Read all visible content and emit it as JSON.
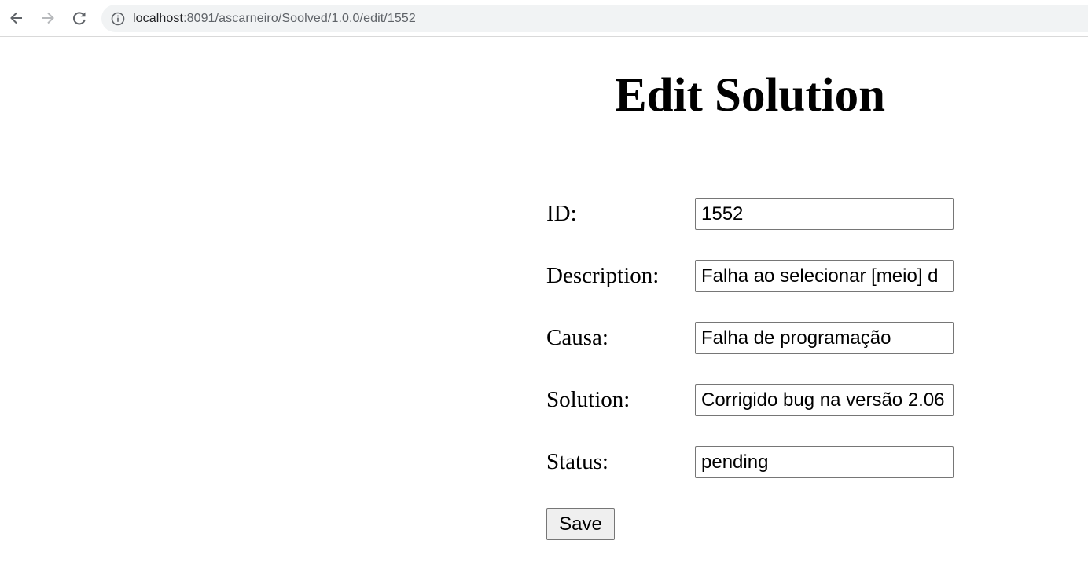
{
  "browser": {
    "url_host": "localhost",
    "url_path": ":8091/ascarneiro/Soolved/1.0.0/edit/1552"
  },
  "page": {
    "title": "Edit Solution"
  },
  "form": {
    "fields": [
      {
        "label": "ID:",
        "value": "1552"
      },
      {
        "label": "Description:",
        "value": "Falha ao selecionar [meio] d"
      },
      {
        "label": "Causa:",
        "value": "Falha de programação"
      },
      {
        "label": "Solution:",
        "value": "Corrigido bug na versão 2.06"
      },
      {
        "label": "Status:",
        "value": "pending"
      }
    ],
    "save_label": "Save"
  }
}
